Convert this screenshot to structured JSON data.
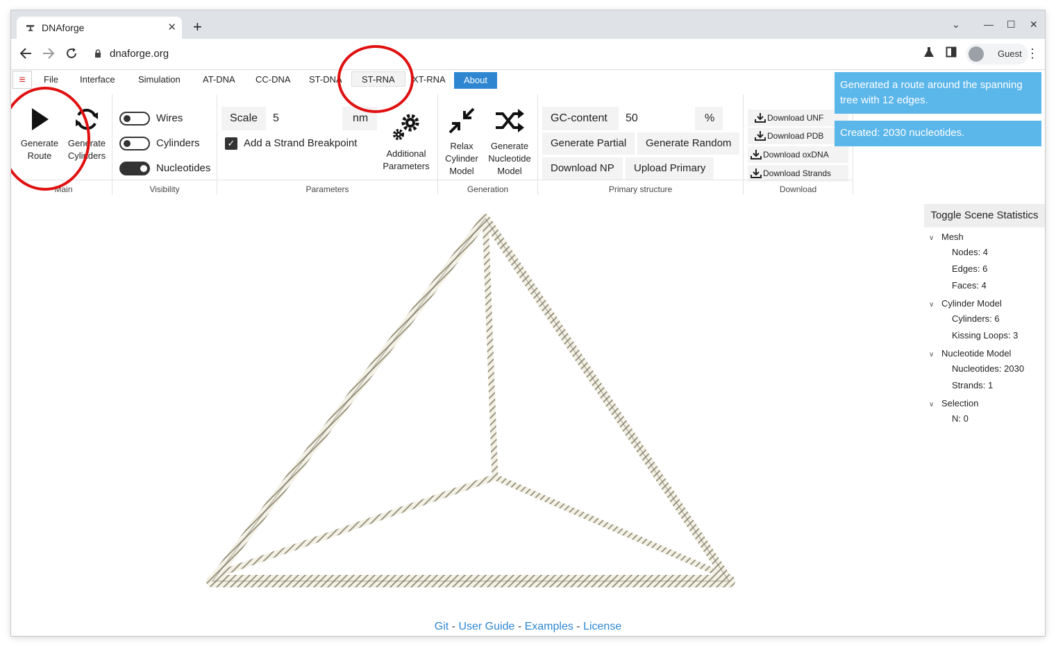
{
  "browser": {
    "tab_title": "DNAforge",
    "tab_close": "✕",
    "new_tab": "+",
    "url": "dnaforge.org",
    "profile_label": "Guest",
    "window_controls": [
      "⌄",
      "—",
      "☐",
      "✕"
    ]
  },
  "menubar": {
    "hamburger": "≡",
    "items": [
      "File",
      "Interface",
      "Simulation",
      "AT-DNA",
      "CC-DNA",
      "ST-DNA",
      "ST-RNA",
      "XT-RNA",
      "About"
    ],
    "active_item": "ST-RNA",
    "highlight_item": "About",
    "highlight_color": "#2e86d1"
  },
  "ribbon": {
    "main": {
      "label": "Main",
      "generate_route": [
        "Generate",
        "Route"
      ],
      "generate_cylinders": [
        "Generate",
        "Cylinders"
      ]
    },
    "visibility": {
      "label": "Visibility",
      "toggles": [
        {
          "label": "Wires",
          "on": false
        },
        {
          "label": "Cylinders",
          "on": false
        },
        {
          "label": "Nucleotides",
          "on": true
        }
      ]
    },
    "parameters": {
      "label": "Parameters",
      "scale_label": "Scale",
      "scale_value": "5",
      "scale_unit": "nm",
      "breakpoint_label": "Add a Strand Breakpoint",
      "breakpoint_checked": true,
      "additional": [
        "Additional",
        "Parameters"
      ]
    },
    "generation": {
      "label": "Generation",
      "relax": [
        "Relax",
        "Cylinder",
        "Model"
      ],
      "generate_nucleotide": [
        "Generate",
        "Nucleotide",
        "Model"
      ]
    },
    "primary": {
      "label": "Primary structure",
      "gc_label": "GC-content",
      "gc_value": "50",
      "gc_unit": "%",
      "generate_partial": "Generate Partial",
      "generate_random": "Generate Random",
      "download_np": "Download NP",
      "upload_primary": "Upload Primary"
    },
    "download": {
      "label": "Download",
      "items": [
        "Download UNF",
        "Download PDB",
        "Download oxDNA",
        "Download Strands"
      ]
    }
  },
  "notifications": [
    "Generated a route around the spanning tree with 12 edges.",
    "Created: 2030 nucleotides."
  ],
  "notification_color": "#5bb6ea",
  "stats": {
    "toggle_label": "Toggle Scene Statistics",
    "sections": [
      {
        "title": "Mesh",
        "items": [
          "Nodes: 4",
          "Edges: 6",
          "Faces: 4"
        ]
      },
      {
        "title": "Cylinder Model",
        "items": [
          "Cylinders: 6",
          "Kissing Loops: 3"
        ]
      },
      {
        "title": "Nucleotide Model",
        "items": [
          "Nucleotides: 2030",
          "Strands: 1"
        ]
      },
      {
        "title": "Selection",
        "items": [
          "N: 0"
        ]
      }
    ]
  },
  "footer": {
    "links": [
      "Git",
      "User Guide",
      "Examples",
      "License"
    ],
    "separator": " - "
  },
  "annotation_color": "#e01010"
}
